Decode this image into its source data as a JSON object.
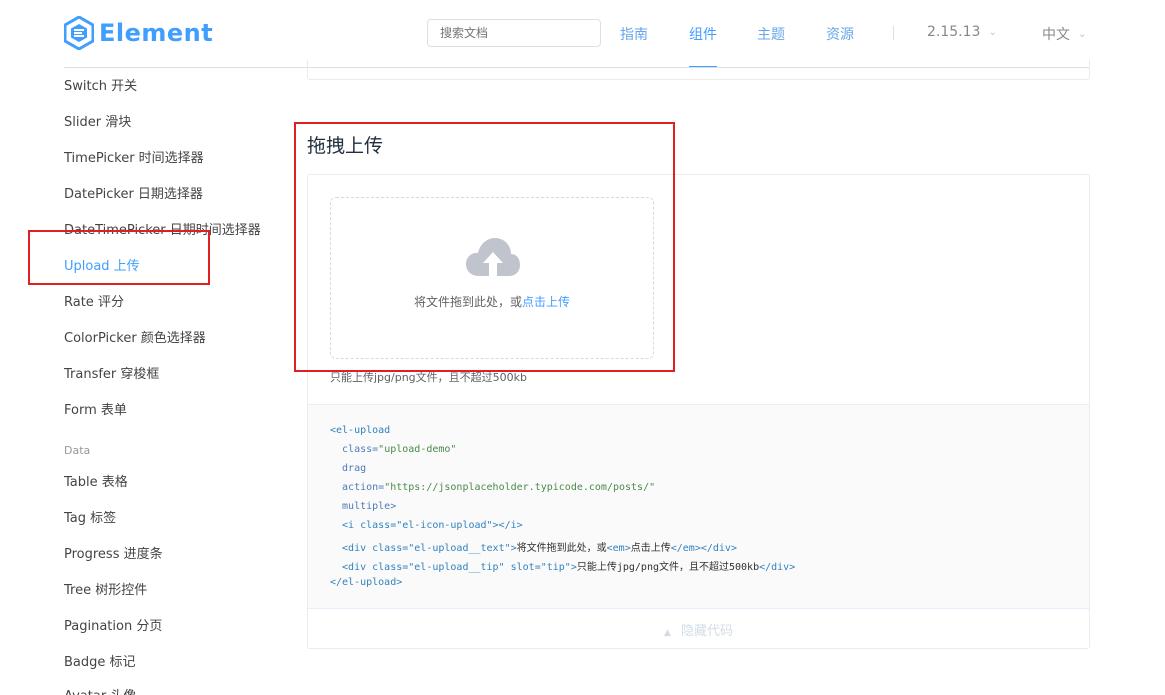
{
  "header": {
    "logo_text": "Element",
    "search_placeholder": "搜索文档",
    "nav": [
      "指南",
      "组件",
      "主题",
      "资源"
    ],
    "active_nav": "组件",
    "version": "2.15.13",
    "language": "中文",
    "brand_color": "#409eff"
  },
  "sidebar": {
    "items_top": [
      "Switch 开关",
      "Slider 滑块",
      "TimePicker 时间选择器",
      "DatePicker 日期选择器",
      "DateTimePicker 日期时间选择器",
      "Upload 上传",
      "Rate 评分",
      "ColorPicker 颜色选择器",
      "Transfer 穿梭框",
      "Form 表单"
    ],
    "active_item": "Upload 上传",
    "group_label": "Data",
    "items_bottom": [
      "Table 表格",
      "Tag 标签",
      "Progress 进度条",
      "Tree 树形控件",
      "Pagination 分页",
      "Badge 标记",
      "Avatar 头像"
    ]
  },
  "content": {
    "section_title": "拖拽上传",
    "upload": {
      "text_prefix": "将文件拖到此处，或",
      "text_link": "点击上传",
      "tip": "只能上传jpg/png文件，且不超过500kb"
    },
    "code": {
      "l1": "<el-upload",
      "l2_attr": "  class=",
      "l2_val": "\"upload-demo\"",
      "l3": "  drag",
      "l4_attr": "  action=",
      "l4_val": "\"https://jsonplaceholder.typicode.com/posts/\"",
      "l5": "  multiple>",
      "l6": "  <i class=\"el-icon-upload\"></i>",
      "l7_open": "  <div class=\"el-upload__text\">",
      "l7_text": "将文件拖到此处，或",
      "l7_em": "<em>",
      "l7_em_text": "点击上传",
      "l7_close": "</em></div>",
      "l8_open": "  <div class=\"el-upload__tip\" slot=\"tip\">",
      "l8_text": "只能上传jpg/png文件，且不超过500kb",
      "l8_close": "</div>",
      "l9": "</el-upload>"
    },
    "toggle_label": "隐藏代码"
  }
}
